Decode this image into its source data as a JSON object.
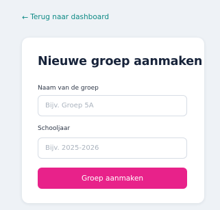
{
  "nav": {
    "back_arrow": "←",
    "back_label": "Terug naar dashboard"
  },
  "form": {
    "title": "Nieuwe groep aanmaken",
    "group_name_label": "Naam van de groep",
    "group_name_placeholder": "Bijv. Groep 5A",
    "group_name_value": "",
    "school_year_label": "Schooljaar",
    "school_year_placeholder": "Bijv. 2025-2026",
    "school_year_value": "",
    "submit_label": "Groep aanmaken"
  },
  "colors": {
    "accent": "#e8228a",
    "link": "#0f8b86",
    "background": "#eef2f6",
    "title": "#17233a"
  }
}
